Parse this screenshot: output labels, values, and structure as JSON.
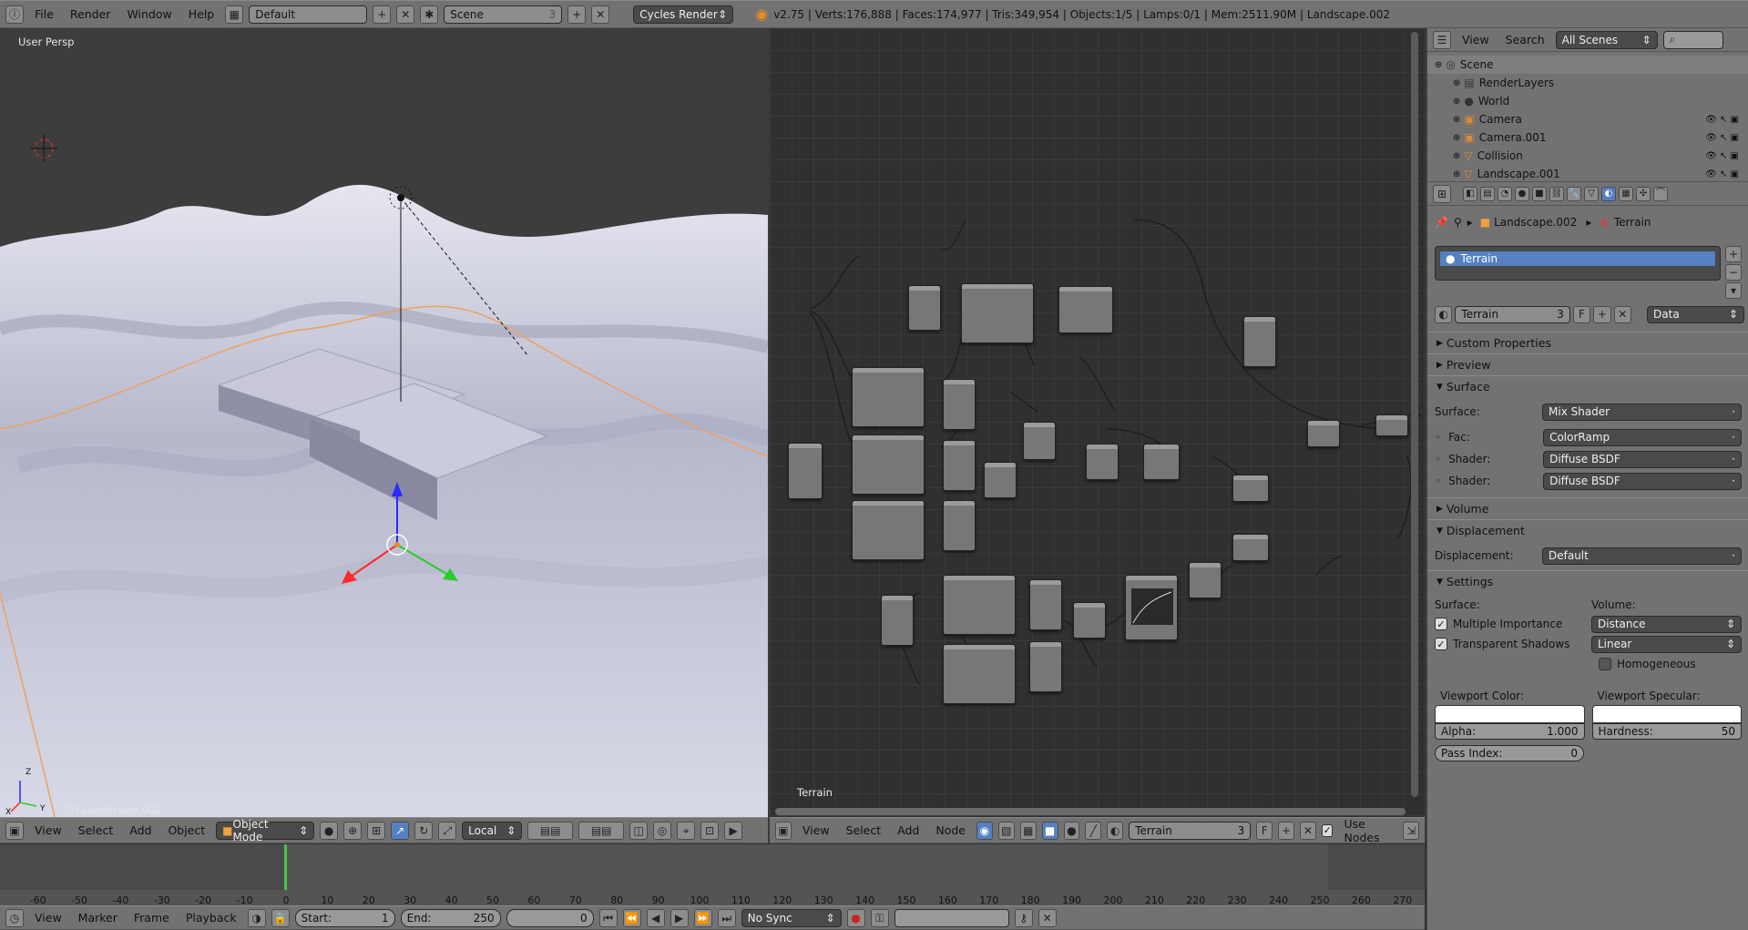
{
  "top_bar": {
    "menus": [
      "File",
      "Render",
      "Window",
      "Help"
    ],
    "layout": "Default",
    "scene": "Scene",
    "scene_users": "3",
    "engine": "Cycles Render",
    "stats": "v2.75 | Verts:176,888 | Faces:174,977 | Tris:349,954 | Objects:1/5 | Lamps:0/1 | Mem:2511.90M | Landscape.002"
  },
  "viewport": {
    "view_name": "User Persp",
    "object_label": "(0) Landscape.002",
    "axis_x": "X",
    "axis_y": "Y",
    "axis_z": "Z",
    "header": {
      "menus": [
        "View",
        "Select",
        "Add",
        "Object"
      ],
      "mode": "Object Mode",
      "pivot": "Local"
    }
  },
  "node_editor": {
    "label": "Terrain",
    "header": {
      "menus": [
        "View",
        "Select",
        "Add",
        "Node"
      ],
      "material": "Terrain",
      "users": "3",
      "fake": "F",
      "use_nodes": "Use Nodes"
    }
  },
  "outliner": {
    "menus": [
      "View",
      "Search"
    ],
    "filter": "All Scenes",
    "items": [
      {
        "label": "Scene",
        "indent": 0
      },
      {
        "label": "RenderLayers",
        "indent": 1
      },
      {
        "label": "World",
        "indent": 1
      },
      {
        "label": "Camera",
        "indent": 1
      },
      {
        "label": "Camera.001",
        "indent": 1
      },
      {
        "label": "Collision",
        "indent": 1
      },
      {
        "label": "Landscape.001",
        "indent": 1
      }
    ]
  },
  "properties": {
    "breadcrumb_object": "Landscape.002",
    "breadcrumb_material": "Terrain",
    "slot_name": "Terrain",
    "material_name": "Terrain",
    "material_users": "3",
    "material_fake": "F",
    "link": "Data",
    "panels": {
      "custom_properties": "Custom Properties",
      "preview": "Preview",
      "surface": "Surface",
      "volume": "Volume",
      "displacement": "Displacement",
      "settings": "Settings"
    },
    "surface_label": "Surface:",
    "surface_value": "Mix Shader",
    "fac_label": "Fac:",
    "fac_value": "ColorRamp",
    "shader1_label": "Shader:",
    "shader1_value": "Diffuse BSDF",
    "shader2_label": "Shader:",
    "shader2_value": "Diffuse BSDF",
    "displacement_label": "Displacement:",
    "displacement_value": "Default",
    "settings_surface": "Surface:",
    "settings_volume": "Volume:",
    "multiple_importance": "Multiple Importance",
    "transparent_shadows": "Transparent Shadows",
    "volume_sampling": "Distance",
    "volume_interpolation": "Linear",
    "homogeneous": "Homogeneous",
    "viewport_color": "Viewport Color:",
    "viewport_specular": "Viewport Specular:",
    "alpha_label": "Alpha:",
    "alpha_value": "1.000",
    "hardness_label": "Hardness:",
    "hardness_value": "50",
    "pass_index_label": "Pass Index:",
    "pass_index_value": "0"
  },
  "timeline": {
    "menus": [
      "View",
      "Marker",
      "Frame",
      "Playback"
    ],
    "start_label": "Start:",
    "start": "1",
    "end_label": "End:",
    "end": "250",
    "current": "0",
    "sync": "No Sync",
    "ticks": [
      "-60",
      "-50",
      "-40",
      "-30",
      "-20",
      "-10",
      "0",
      "10",
      "20",
      "30",
      "40",
      "50",
      "60",
      "70",
      "80",
      "90",
      "100",
      "110",
      "120",
      "130",
      "140",
      "150",
      "160",
      "170",
      "180",
      "190",
      "200",
      "210",
      "220",
      "230",
      "240",
      "250",
      "260",
      "270"
    ]
  },
  "colors": {
    "header_bg": "#727272",
    "viewport_bg": "#3d3d3d",
    "node_bg": "#303030",
    "selection_blue": "#5680c2",
    "terrain": "#c9cbdc"
  }
}
